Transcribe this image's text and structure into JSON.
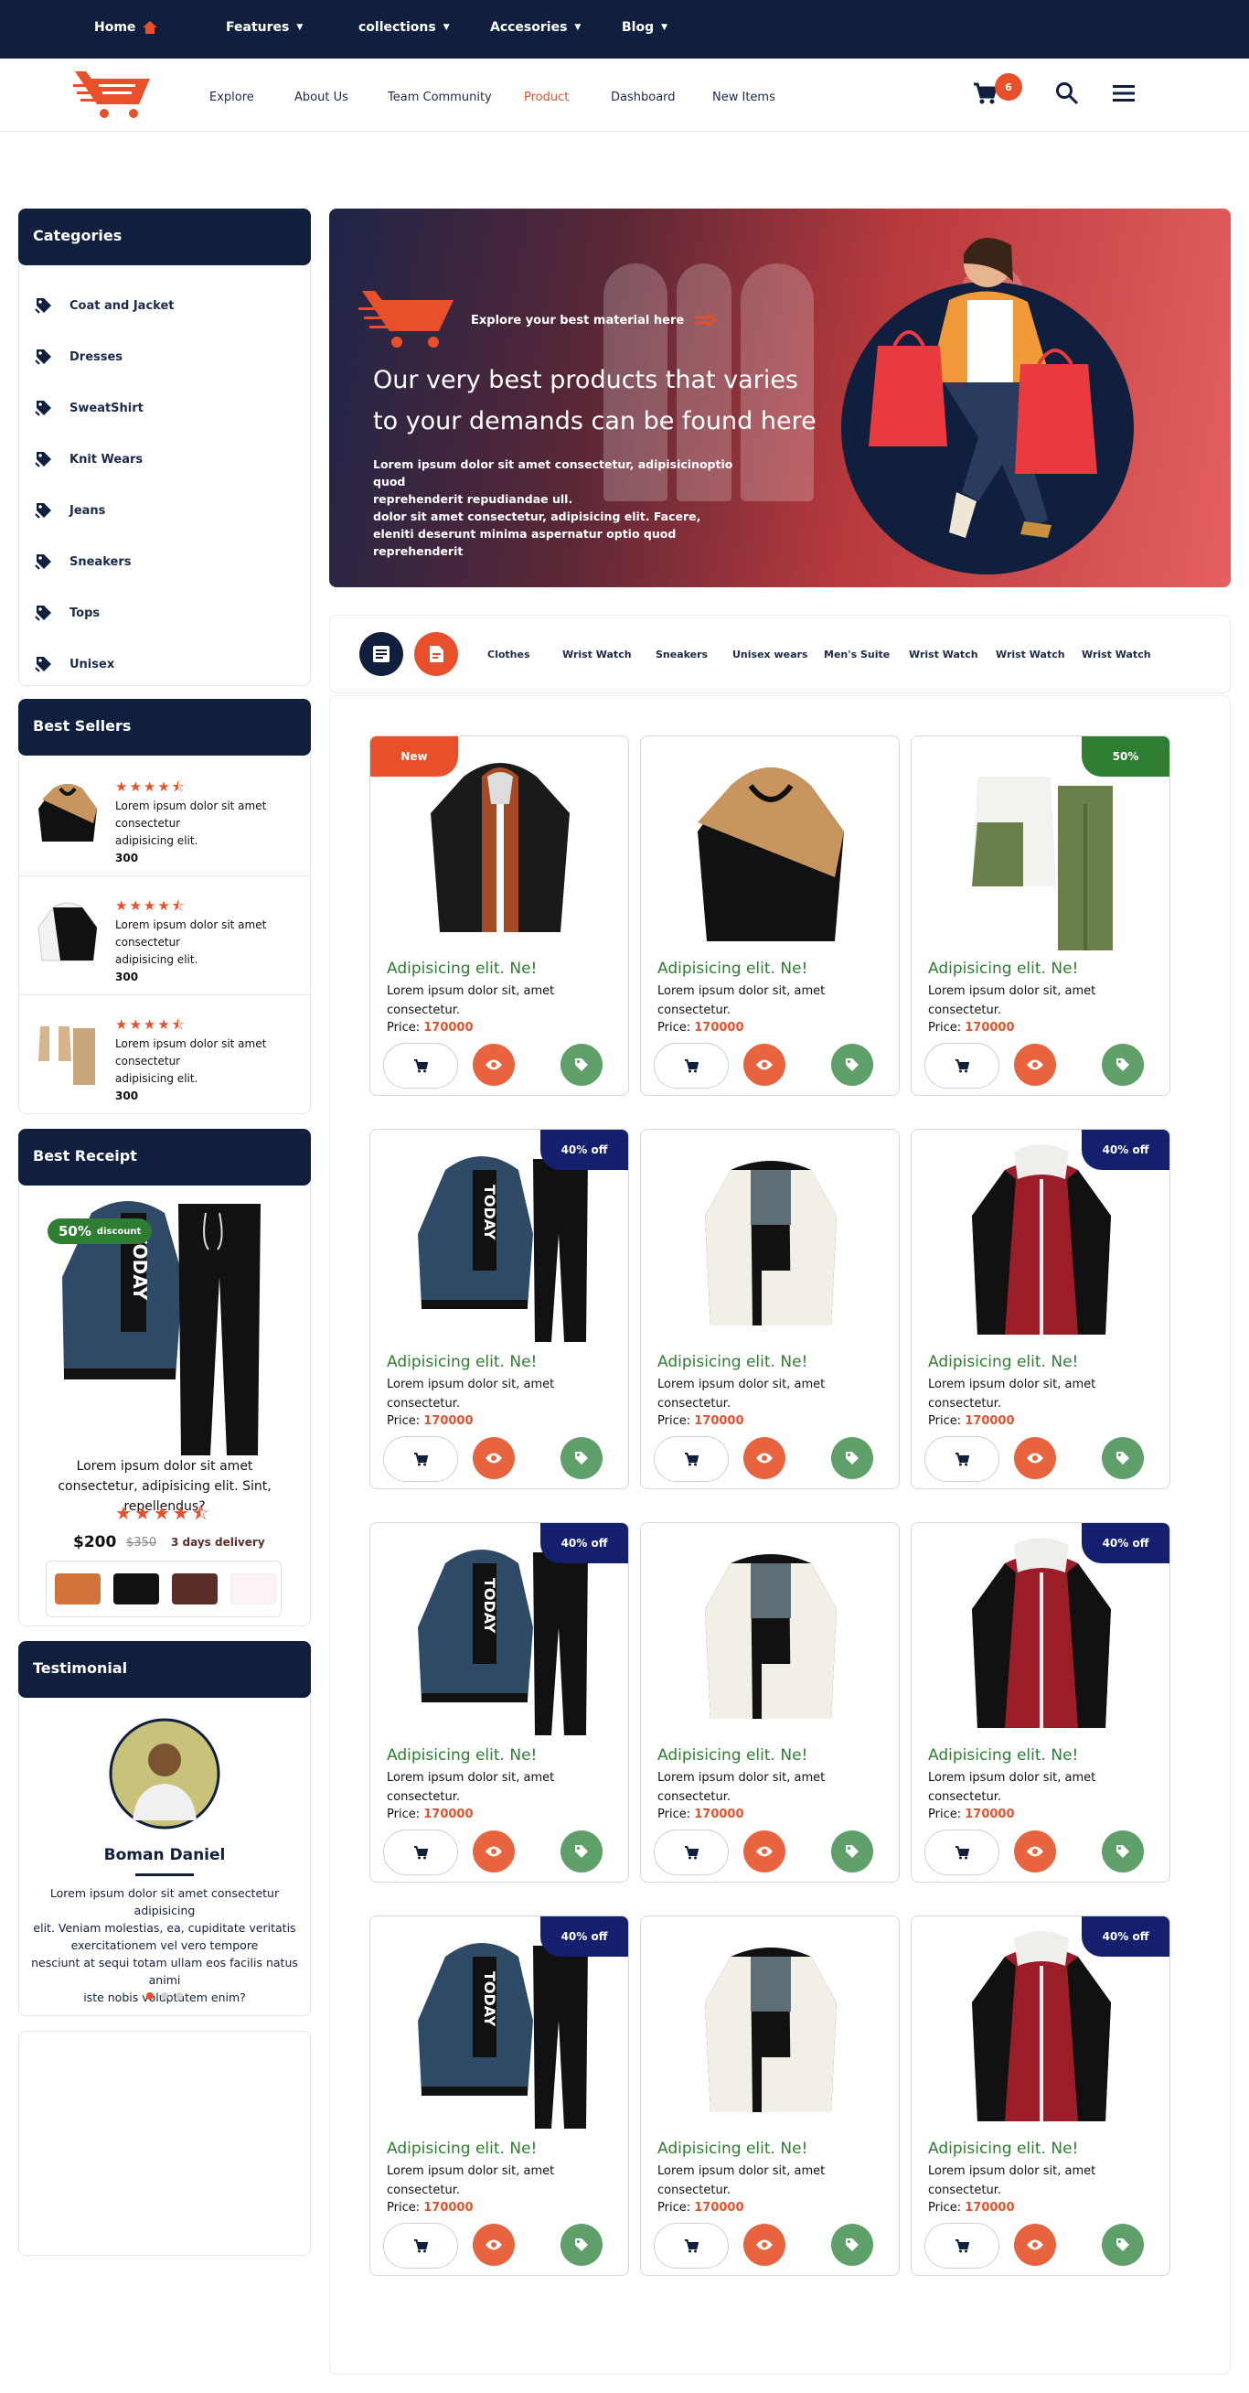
{
  "topbar": {
    "items": [
      {
        "label": "Home"
      },
      {
        "label": "Features"
      },
      {
        "label": "collections"
      },
      {
        "label": "Accesories"
      },
      {
        "label": "Blog"
      }
    ]
  },
  "navbar": {
    "items": [
      "Explore",
      "About Us",
      "Team Community",
      "Product",
      "Dashboard",
      "New Items"
    ],
    "active": "Product",
    "cart_count": "6"
  },
  "categories": {
    "title": "Categories",
    "items": [
      "Coat and Jacket",
      "Dresses",
      "SweatShirt",
      "Knit Wears",
      "Jeans",
      "Sneakers",
      "Tops",
      "Unisex"
    ]
  },
  "best_sellers": {
    "title": "Best Sellers",
    "items": [
      {
        "rating": "★★★★⯪",
        "line1": "Lorem ipsum dolor sit amet",
        "line2": "consectetur",
        "line3": "adipisicing elit.",
        "price": "300"
      },
      {
        "rating": "★★★★⯪",
        "line1": "Lorem ipsum dolor sit amet",
        "line2": "consectetur",
        "line3": "adipisicing elit.",
        "price": "300"
      },
      {
        "rating": "★★★★⯪",
        "line1": "Lorem ipsum dolor sit amet",
        "line2": "consectetur",
        "line3": "adipisicing elit.",
        "price": "300"
      }
    ]
  },
  "best_receipt": {
    "title": "Best Receipt",
    "discount_pct": "50%",
    "discount_label": "discount",
    "description": "Lorem ipsum dolor sit amet consectetur, adipisicing elit. Sint, repellendus?",
    "rating": "★★★★⯪",
    "price": "$200",
    "old_price": "$350",
    "delivery": "3 days delivery",
    "colors": [
      "#d1743a",
      "#111111",
      "#5a2d27",
      "#fdf3f5"
    ]
  },
  "testimonial": {
    "title": "Testimonial",
    "name": "Boman Daniel",
    "text_lines": [
      "Lorem ipsum dolor sit amet consectetur adipisicing",
      "elit. Veniam molestias, ea, cupiditate veritatis",
      "exercitationem vel vero tempore",
      "nesciunt at sequi totam ullam eos facilis natus animi",
      "iste nobis voluptatem enim?"
    ]
  },
  "hero": {
    "kicker": "Explore your best material here",
    "title_line1": "Our very best products that varies",
    "title_line2": "to your demands can be found here",
    "body_lines": [
      "Lorem ipsum dolor sit amet consectetur, adipisicinoptio quod",
      "reprehenderit repudiandae ull.",
      "dolor sit amet consectetur, adipisicing elit. Facere,",
      "eleniti deserunt minima aspernatur optio quod reprehenderit"
    ]
  },
  "filters": {
    "tabs": [
      "Clothes",
      "Wrist Watch",
      "Sneakers",
      "Unisex wears",
      "Men's Suite",
      "Wrist Watch",
      "Wrist Watch",
      "Wrist Watch"
    ]
  },
  "products": [
    {
      "badge": "New",
      "title": "Adipisicing elit. Ne!",
      "desc1": "Lorem ipsum dolor sit, amet",
      "desc2": "consectetur.",
      "price_label": "Price:",
      "price": "170000"
    },
    {
      "badge": "",
      "title": "Adipisicing elit. Ne!",
      "desc1": "Lorem ipsum dolor sit, amet",
      "desc2": "consectetur.",
      "price_label": "Price:",
      "price": "170000"
    },
    {
      "badge": "50%",
      "title": "Adipisicing elit. Ne!",
      "desc1": "Lorem ipsum dolor sit, amet",
      "desc2": "consectetur.",
      "price_label": "Price:",
      "price": "170000"
    },
    {
      "badge": "40% off",
      "title": "Adipisicing elit. Ne!",
      "desc1": "Lorem ipsum dolor sit, amet",
      "desc2": "consectetur.",
      "price_label": "Price:",
      "price": "170000"
    },
    {
      "badge": "",
      "title": "Adipisicing elit. Ne!",
      "desc1": "Lorem ipsum dolor sit, amet",
      "desc2": "consectetur.",
      "price_label": "Price:",
      "price": "170000"
    },
    {
      "badge": "40% off",
      "title": "Adipisicing elit. Ne!",
      "desc1": "Lorem ipsum dolor sit, amet",
      "desc2": "consectetur.",
      "price_label": "Price:",
      "price": "170000"
    },
    {
      "badge": "40% off",
      "title": "Adipisicing elit. Ne!",
      "desc1": "Lorem ipsum dolor sit, amet",
      "desc2": "consectetur.",
      "price_label": "Price:",
      "price": "170000"
    },
    {
      "badge": "",
      "title": "Adipisicing elit. Ne!",
      "desc1": "Lorem ipsum dolor sit, amet",
      "desc2": "consectetur.",
      "price_label": "Price:",
      "price": "170000"
    },
    {
      "badge": "40% off",
      "title": "Adipisicing elit. Ne!",
      "desc1": "Lorem ipsum dolor sit, amet",
      "desc2": "consectetur.",
      "price_label": "Price:",
      "price": "170000"
    },
    {
      "badge": "40% off",
      "title": "Adipisicing elit. Ne!",
      "desc1": "Lorem ipsum dolor sit, amet",
      "desc2": "consectetur.",
      "price_label": "Price:",
      "price": "170000"
    },
    {
      "badge": "",
      "title": "Adipisicing elit. Ne!",
      "desc1": "Lorem ipsum dolor sit, amet",
      "desc2": "consectetur.",
      "price_label": "Price:",
      "price": "170000"
    },
    {
      "badge": "40% off",
      "title": "Adipisicing elit. Ne!",
      "desc1": "Lorem ipsum dolor sit, amet",
      "desc2": "consectetur.",
      "price_label": "Price:",
      "price": "170000"
    }
  ],
  "colors": {
    "navy": "#0f1f3d",
    "accent_orange": "#e8502b",
    "green": "#2e7d32",
    "badge_navy": "#14206e"
  }
}
